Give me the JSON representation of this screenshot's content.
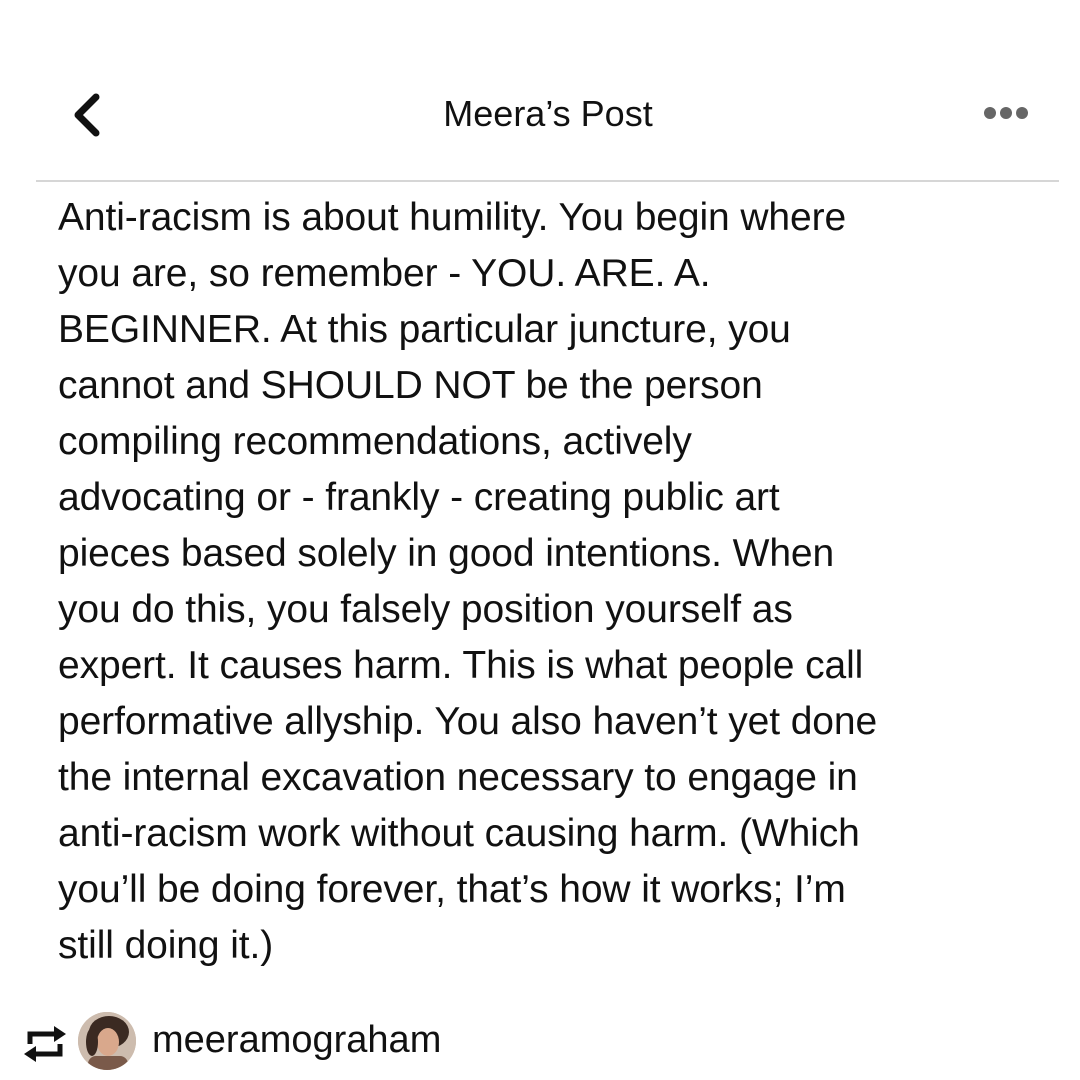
{
  "header": {
    "title": "Meera’s Post",
    "back_icon": "chevron-left-icon",
    "more_icon": "more-horizontal-icon"
  },
  "post": {
    "lines": [
      "Anti-racism is about humility. You begin where",
      "you are, so remember - YOU. ARE. A.",
      "BEGINNER. At this particular juncture, you",
      "cannot and SHOULD NOT be the person",
      "compiling recommendations, actively",
      "advocating or - frankly - creating public art",
      "pieces based solely in good intentions. When",
      "you do this, you falsely position yourself as",
      "expert. It causes harm. This is what people call",
      "performative allyship. You also haven’t yet done",
      "the internal excavation necessary to engage in",
      "anti-racism work without causing harm. (Which",
      "you’ll be doing forever, that’s how it works; I’m",
      "still doing it.)"
    ]
  },
  "footer": {
    "repost_icon": "repost-icon",
    "username": "meeramograham"
  },
  "colors": {
    "background": "#ffffff",
    "text": "#111111",
    "divider": "#d6d6d6"
  }
}
